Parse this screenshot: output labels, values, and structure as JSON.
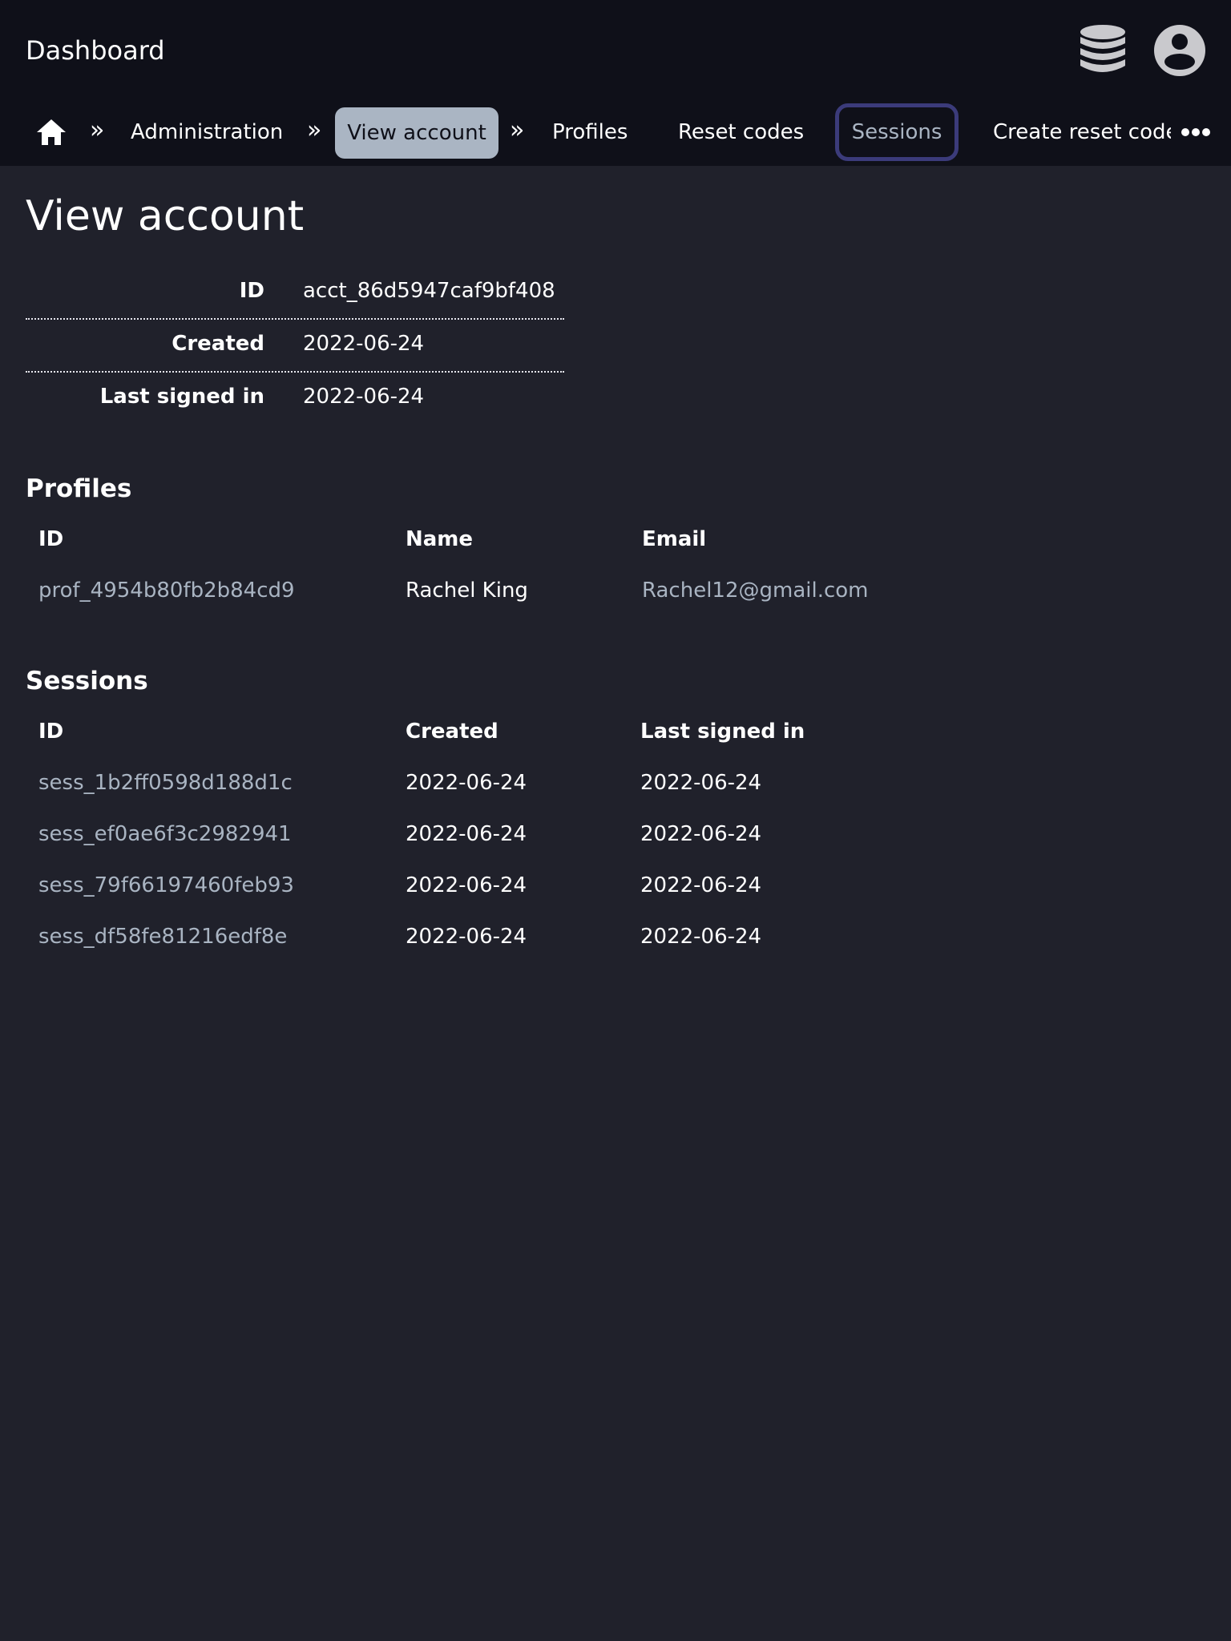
{
  "app": {
    "title": "Dashboard",
    "icons": {
      "database": "database-icon",
      "account": "account-circle-icon",
      "home": "home-icon",
      "more": "more-horizontal-icon"
    }
  },
  "nav": {
    "separator": "»",
    "items": [
      {
        "label": "Administration"
      },
      {
        "label": "View account",
        "state": "active"
      },
      {
        "label": "Profiles"
      },
      {
        "label": "Reset codes"
      },
      {
        "label": "Sessions",
        "state": "focused"
      },
      {
        "label": "Create reset code"
      }
    ]
  },
  "page": {
    "title": "View account"
  },
  "account": {
    "fields": [
      {
        "label": "ID",
        "value": "acct_86d5947caf9bf408"
      },
      {
        "label": "Created",
        "value": "2022-06-24"
      },
      {
        "label": "Last signed in",
        "value": "2022-06-24"
      }
    ]
  },
  "profiles": {
    "title": "Profiles",
    "columns": [
      "ID",
      "Name",
      "Email"
    ],
    "rows": [
      {
        "id": "prof_4954b80fb2b84cd9",
        "name": "Rachel King",
        "email": "Rachel12@gmail.com"
      }
    ]
  },
  "sessions": {
    "title": "Sessions",
    "columns": [
      "ID",
      "Created",
      "Last signed in"
    ],
    "rows": [
      {
        "id": "sess_1b2ff0598d188d1c",
        "created": "2022-06-24",
        "last_signed_in": "2022-06-24"
      },
      {
        "id": "sess_ef0ae6f3c2982941",
        "created": "2022-06-24",
        "last_signed_in": "2022-06-24"
      },
      {
        "id": "sess_79f66197460feb93",
        "created": "2022-06-24",
        "last_signed_in": "2022-06-24"
      },
      {
        "id": "sess_df58fe81216edf8e",
        "created": "2022-06-24",
        "last_signed_in": "2022-06-24"
      }
    ]
  },
  "colors": {
    "background": "#20212b",
    "topbar": "#0f1019",
    "active_pill": "#aab5c3",
    "focus_ring": "#3b3b7a",
    "link": "#a9b4c2",
    "text": "#ffffff"
  }
}
